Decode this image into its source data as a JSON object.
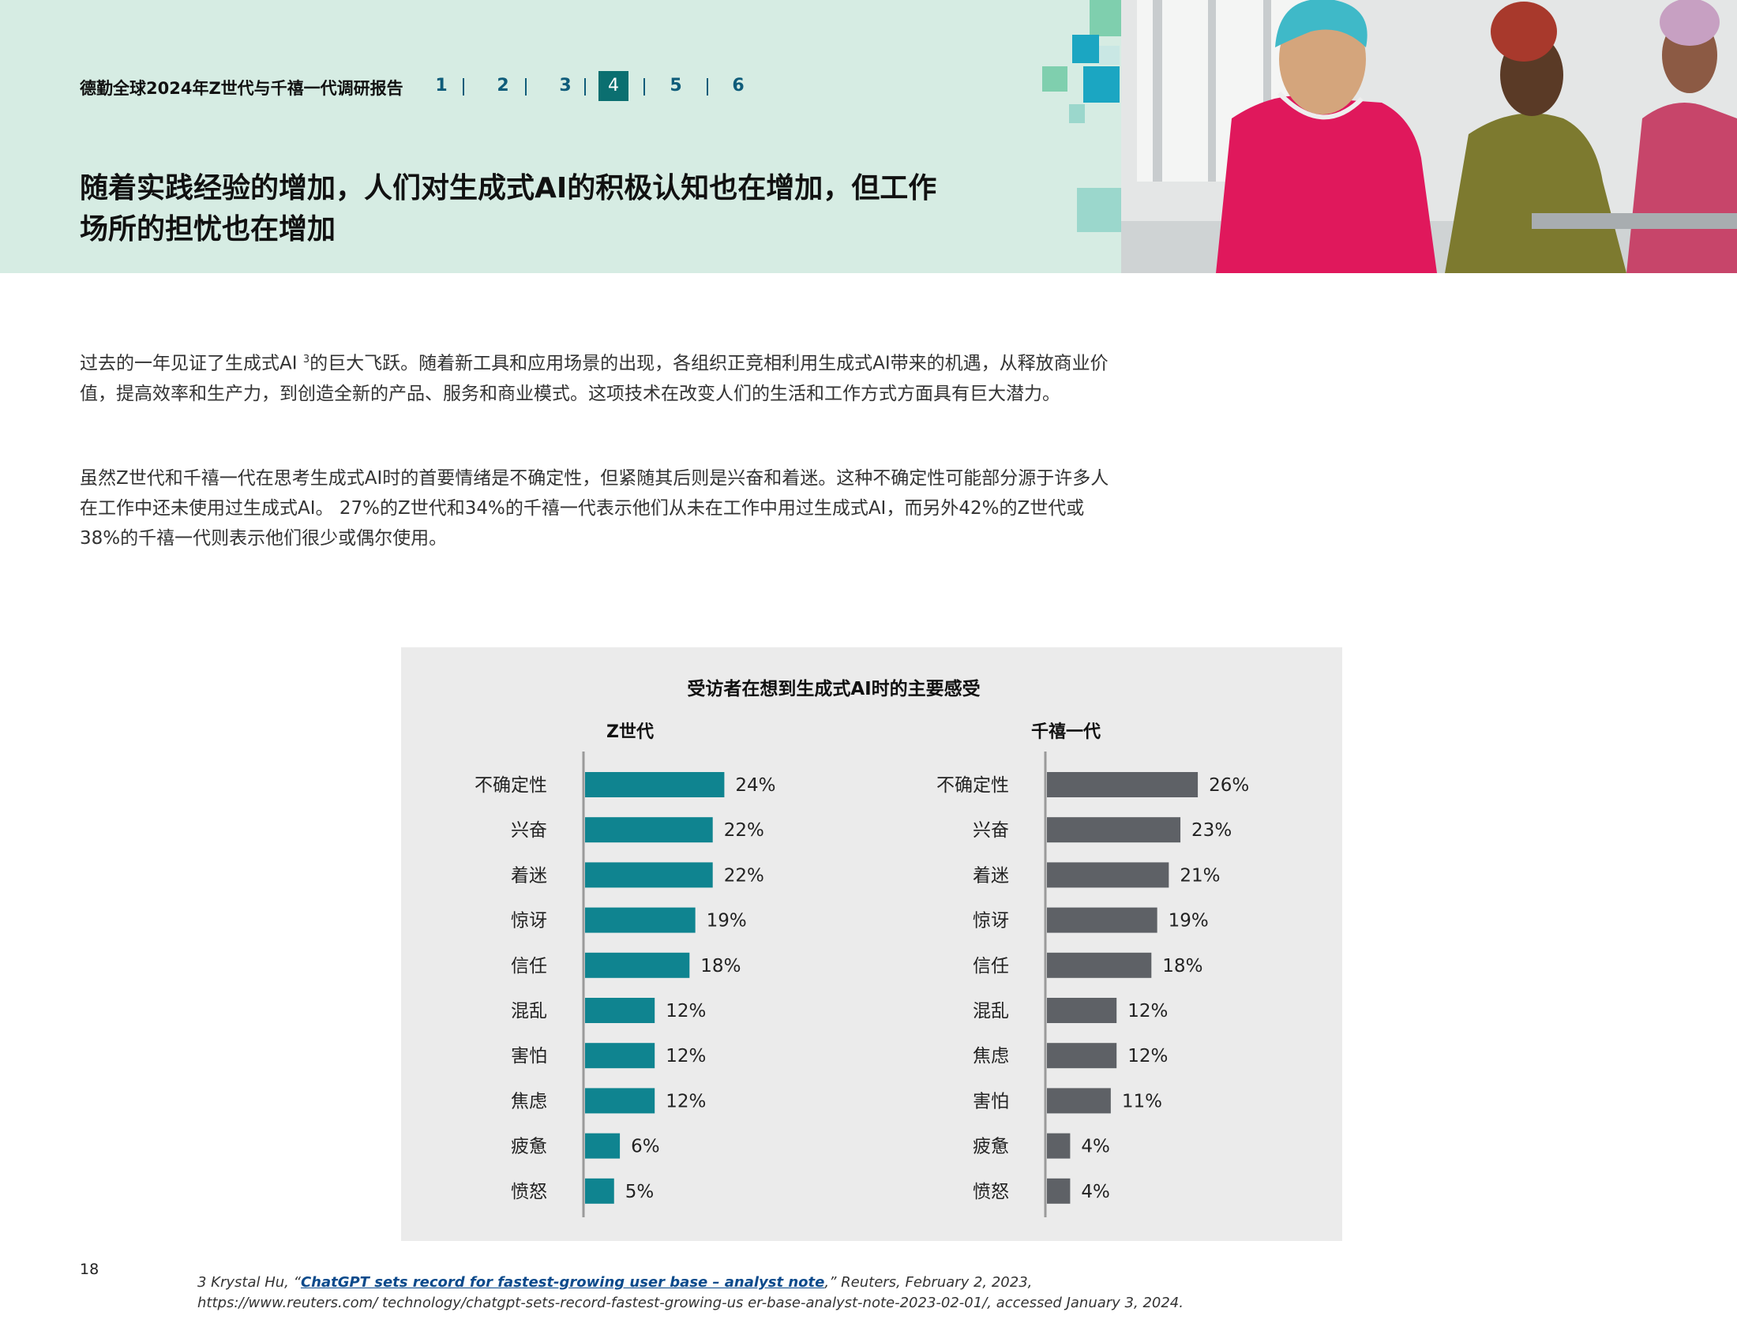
{
  "header": {
    "report_title": "德勤全球2024年Z世代与千禧一代调研报告",
    "nav": [
      {
        "label": "1",
        "active": false
      },
      {
        "label": "2",
        "active": false
      },
      {
        "label": "3",
        "active": false
      },
      {
        "label": "4",
        "active": true
      },
      {
        "label": "5",
        "active": false
      },
      {
        "label": "6",
        "active": false
      }
    ],
    "page_title_line1": "随着实践经验的增加，人们对生成式AI的积极认知也在增加，但工作",
    "page_title_line2": "场所的担忧也在增加",
    "colors": {
      "background": "#d6ece3",
      "nav": "#0f5c7a",
      "nav_active": "#0b6f70"
    }
  },
  "body": {
    "para1_a": "过去的一年见证了生成式AI ",
    "para1_sup": "3",
    "para1_b": "的巨大飞跃。随着新工具和应用场景的出现，各组织正竞相利用生成式AI带来的机遇，从释放商业价值，提高效率和生产力，到创造全新的产品、服务和商业模式。这项技术在改变人们的生活和工作方式方面具有巨大潜力。",
    "para2": "虽然Z世代和千禧一代在思考生成式AI时的首要情绪是不确定性，但紧随其后则是兴奋和着迷。这种不确定性可能部分源于许多人在工作中还未使用过生成式AI。 27%的Z世代和34%的千禧一代表示他们从未在工作中用过生成式AI，而另外42%的Z世代或38%的千禧一代则表示他们很少或偶尔使用。"
  },
  "chart_data": [
    {
      "type": "bar",
      "orientation": "horizontal",
      "title": "受访者在想到生成式AI时的主要感受",
      "subtitle": "Z世代",
      "categories": [
        "不确定性",
        "兴奋",
        "着迷",
        "惊讶",
        "信任",
        "混乱",
        "害怕",
        "焦虑",
        "疲惫",
        "愤怒"
      ],
      "values": [
        24,
        22,
        22,
        19,
        18,
        12,
        12,
        12,
        6,
        5
      ],
      "labels": [
        "24%",
        "22%",
        "22%",
        "19%",
        "18%",
        "12%",
        "12%",
        "12%",
        "6%",
        "5%"
      ],
      "unit": "%",
      "color": "#0f8490"
    },
    {
      "type": "bar",
      "orientation": "horizontal",
      "subtitle": "千禧一代",
      "categories": [
        "不确定性",
        "兴奋",
        "着迷",
        "惊讶",
        "信任",
        "混乱",
        "焦虑",
        "害怕",
        "疲惫",
        "愤怒"
      ],
      "values": [
        26,
        23,
        21,
        19,
        18,
        12,
        12,
        11,
        4,
        4
      ],
      "labels": [
        "26%",
        "23%",
        "21%",
        "19%",
        "18%",
        "12%",
        "12%",
        "11%",
        "4%",
        "4%"
      ],
      "unit": "%",
      "color": "#5e6166"
    }
  ],
  "footer": {
    "page_number": "18",
    "footnote_prefix": "3 Krystal Hu, “",
    "footnote_link": "ChatGPT sets record for fastest-growing user base – analyst note",
    "footnote_suffix": ",” Reuters, February 2, 2023,",
    "footnote_line2": "https://www.reuters.com/ technology/chatgpt-sets-record-fastest-growing-us   er-base-analyst-note-2023-02-01/, accessed January 3, 2024."
  }
}
